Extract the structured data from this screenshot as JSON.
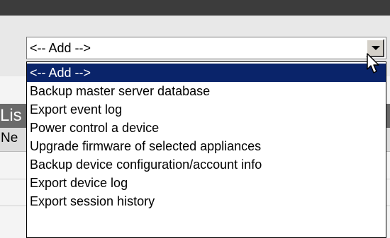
{
  "table": {
    "section_title": "Lis",
    "column_header": "Ne"
  },
  "action_select": {
    "selected_value": "<-- Add -->",
    "options": [
      "<-- Add -->",
      "Backup master server database",
      "Export event log",
      "Power control a device",
      "Upgrade firmware of selected appliances",
      "Backup device configuration/account info",
      "Export device log",
      "Export session history"
    ]
  },
  "colors": {
    "highlight": "#0a246a",
    "top_bar": "#3c3c3c",
    "section_header": "#6a6a6a"
  },
  "icons": {
    "dropdown_arrow": "chevron-down-icon",
    "cursor": "mouse-pointer-icon"
  }
}
